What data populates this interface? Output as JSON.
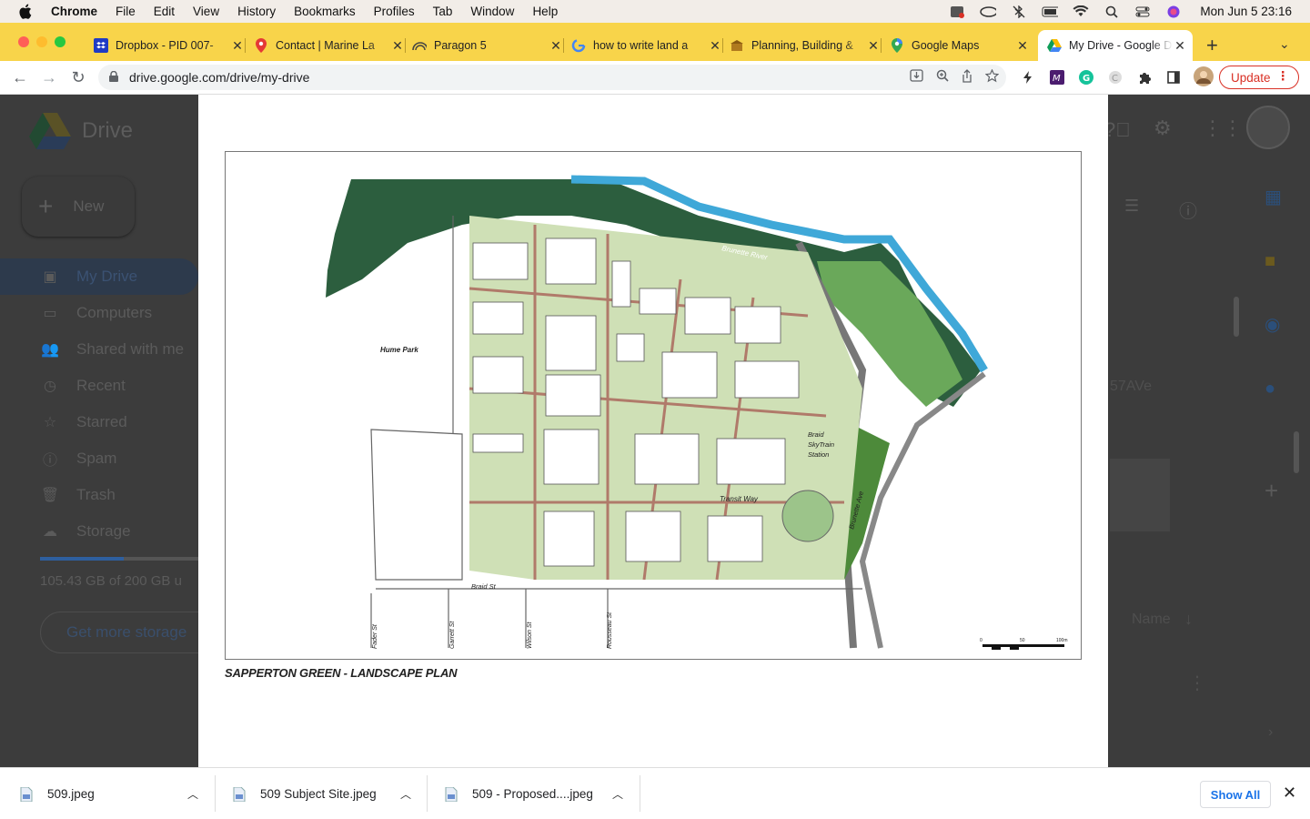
{
  "menubar": {
    "items": [
      "Chrome",
      "File",
      "Edit",
      "View",
      "History",
      "Bookmarks",
      "Profiles",
      "Tab",
      "Window",
      "Help"
    ],
    "clock": "Mon Jun 5  23:16"
  },
  "tabs": [
    {
      "title": "Dropbox - PID 007-",
      "icon": "dropbox-icon"
    },
    {
      "title": "Contact | Marine La",
      "icon": "map-pin-icon"
    },
    {
      "title": "Paragon 5",
      "icon": "paragon-icon"
    },
    {
      "title": "how to write land a",
      "icon": "google-icon"
    },
    {
      "title": "Planning, Building &",
      "icon": "city-icon"
    },
    {
      "title": "Google Maps",
      "icon": "maps-icon"
    },
    {
      "title": "My Drive - Google D",
      "icon": "drive-icon",
      "active": true
    }
  ],
  "omnibox": {
    "url": "drive.google.com/drive/my-drive"
  },
  "toolbar": {
    "update_label": "Update"
  },
  "drive": {
    "logo": "Drive",
    "new_label": "New",
    "nav": [
      "My Drive",
      "Computers",
      "Shared with me",
      "Recent",
      "Starred",
      "Spam",
      "Trash",
      "Storage"
    ],
    "storage_text": "105.43 GB of 200 GB u",
    "storage_used_fraction": 0.53,
    "get_more": "Get more storage",
    "file_hint": "57AVe",
    "sort_label": "Name"
  },
  "plan": {
    "caption": "SAPPERTON GREEN - LANDSCAPE PLAN",
    "labels": {
      "river": "Brunette River",
      "park": "Hume Park",
      "station": [
        "Braid",
        "SkyTrain",
        "Station"
      ],
      "transit_way": "Transit Way",
      "brunette_ave": "Brunette Ave",
      "braid_st": "Braid St",
      "streets": [
        "Fader St",
        "Garrett St",
        "Wilson St",
        "Rousseau St"
      ],
      "scale": [
        "0",
        "50",
        "100m"
      ]
    }
  },
  "downloads": {
    "items": [
      "509.jpeg",
      "509 Subject Site.jpeg",
      "509 - Proposed....jpeg"
    ],
    "show_all": "Show All"
  },
  "colors": {
    "tabstrip": "#f8d44a",
    "update": "#d93025",
    "link_blue": "#1a73e8"
  }
}
